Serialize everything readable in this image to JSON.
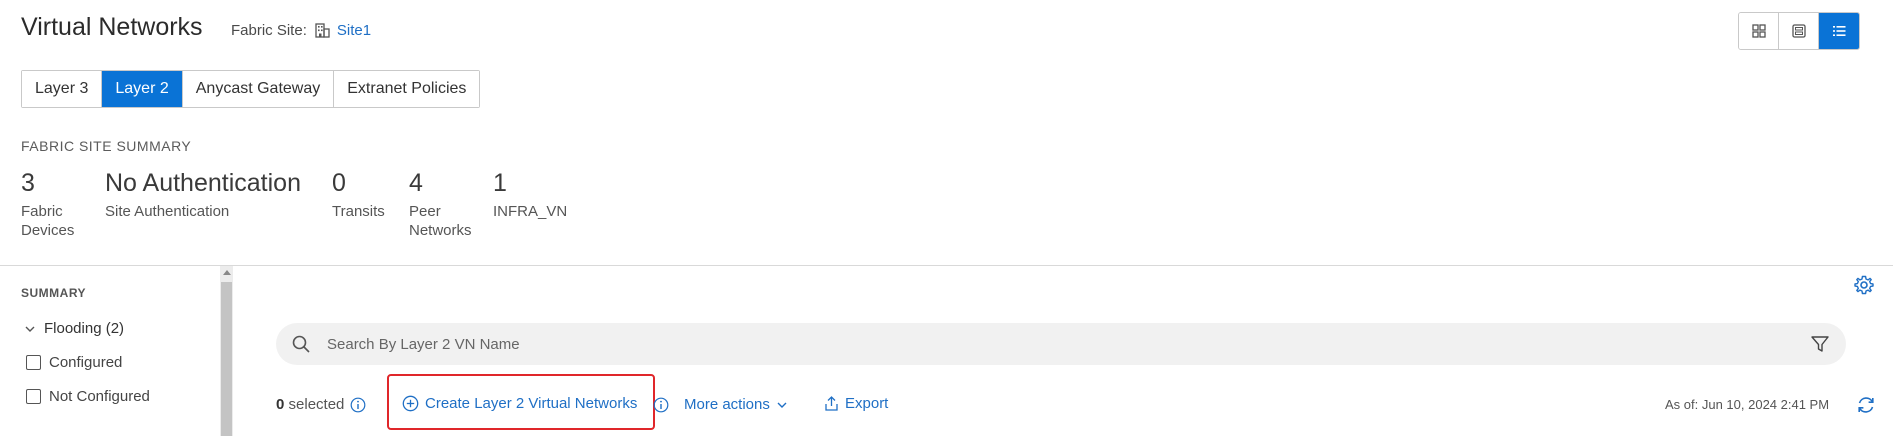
{
  "header": {
    "title": "Virtual Networks",
    "fabric_site_label": "Fabric Site:",
    "fabric_site_value": "Site1"
  },
  "view_toggle": {
    "options": [
      "tile-view",
      "card-view",
      "list-view"
    ],
    "selected": "list-view"
  },
  "tabs": [
    {
      "label": "Layer 3",
      "active": false
    },
    {
      "label": "Layer 2",
      "active": true
    },
    {
      "label": "Anycast Gateway",
      "active": false
    },
    {
      "label": "Extranet Policies",
      "active": false
    }
  ],
  "summary": {
    "heading": "FABRIC SITE SUMMARY",
    "stats": [
      {
        "value": "3",
        "label": "Fabric Devices"
      },
      {
        "value": "No Authentication",
        "label": "Site Authentication"
      },
      {
        "value": "0",
        "label": "Transits"
      },
      {
        "value": "4",
        "label": "Peer Networks"
      },
      {
        "value": "1",
        "label": "INFRA_VN"
      }
    ]
  },
  "sidebar": {
    "heading": "SUMMARY",
    "group_label": "Flooding (2)",
    "options": [
      {
        "label": "Configured",
        "checked": false
      },
      {
        "label": "Not Configured",
        "checked": false
      }
    ]
  },
  "search": {
    "placeholder": "Search By Layer 2 VN Name",
    "value": ""
  },
  "actions": {
    "selected_count": "0",
    "selected_label": "selected",
    "create_label": "Create Layer 2 Virtual Networks",
    "more_actions_label": "More actions",
    "export_label": "Export",
    "as_of": "As of: Jun 10, 2024 2:41 PM"
  },
  "colors": {
    "accent": "#0a73d6",
    "link": "#1f6fc5",
    "highlight_border": "#e0262a"
  }
}
